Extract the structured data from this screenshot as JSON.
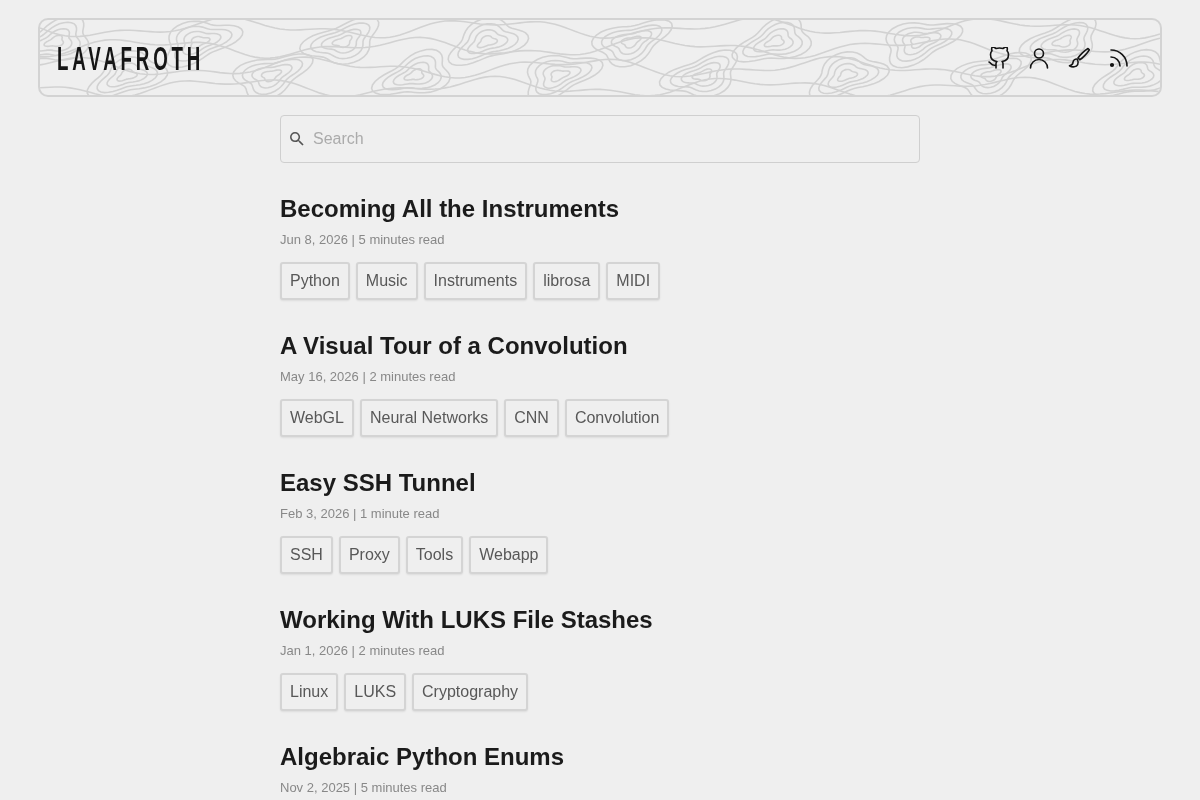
{
  "header": {
    "logo": "LAVAFROTH"
  },
  "search": {
    "placeholder": "Search"
  },
  "posts": [
    {
      "title": "Becoming All the Instruments",
      "meta": "Jun 8, 2026 | 5 minutes read",
      "tags": [
        "Python",
        "Music",
        "Instruments",
        "librosa",
        "MIDI"
      ]
    },
    {
      "title": "A Visual Tour of a Convolution",
      "meta": "May 16, 2026 | 2 minutes read",
      "tags": [
        "WebGL",
        "Neural Networks",
        "CNN",
        "Convolution"
      ]
    },
    {
      "title": "Easy SSH Tunnel",
      "meta": "Feb 3, 2026 | 1 minute read",
      "tags": [
        "SSH",
        "Proxy",
        "Tools",
        "Webapp"
      ]
    },
    {
      "title": "Working With LUKS File Stashes",
      "meta": "Jan 1, 2026 | 2 minutes read",
      "tags": [
        "Linux",
        "LUKS",
        "Cryptography"
      ]
    },
    {
      "title": "Algebraic Python Enums",
      "meta": "Nov 2, 2025 | 5 minutes read"
    }
  ]
}
